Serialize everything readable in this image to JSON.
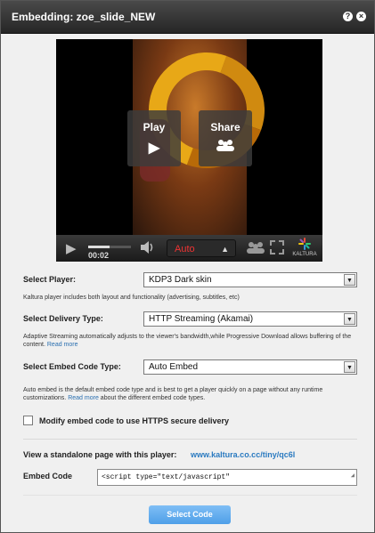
{
  "dialog": {
    "title": "Embedding: zoe_slide_NEW",
    "help_icon": "?",
    "close_icon": "×"
  },
  "player": {
    "play_label": "Play",
    "share_label": "Share",
    "time": "00:02",
    "quality": "Auto",
    "progress_fraction": 0.5,
    "brand": "KALTURA",
    "icons": [
      "play-icon",
      "volume-icon",
      "people-icon",
      "fullscreen-icon",
      "kaltura-logo-icon"
    ]
  },
  "form": {
    "select_player_label": "Select Player:",
    "select_player_value": "KDP3 Dark skin",
    "select_player_help": "Kaltura player includes both layout and functionality (advertising, subtitles, etc)",
    "delivery_label": "Select Delivery Type:",
    "delivery_value": "HTTP Streaming (Akamai)",
    "delivery_help": "Adaptive Streaming automatically adjusts to the viewer's bandwidth,while Progressive Download allows buffering of the content.",
    "delivery_help_link": "Read more",
    "embed_type_label": "Select Embed Code Type:",
    "embed_type_value": "Auto Embed",
    "embed_type_help_prefix": "Auto embed is the default embed code type and is best to get a player quickly on a page without any runtime customizations.",
    "embed_type_help_link": "Read more",
    "embed_type_help_suffix": "about the different embed code types.",
    "https_label": "Modify embed code to use HTTPS secure delivery",
    "https_checked": false,
    "standalone_label": "View a standalone page with this player:",
    "standalone_link": "www.kaltura.co.cc/tiny/qc6l",
    "embed_code_label": "Embed Code",
    "embed_code_value": "<script type=\"text/javascript\""
  },
  "footer": {
    "select_code_label": "Select Code"
  }
}
